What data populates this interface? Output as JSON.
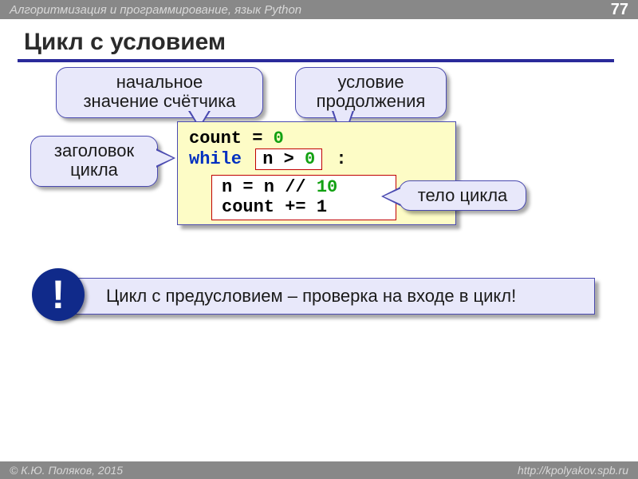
{
  "header": {
    "course": "Алгоритмизация и программирование, язык Python",
    "page": "77"
  },
  "title": "Цикл с условием",
  "callouts": {
    "initial": "начальное\nзначение счётчика",
    "condition": "условие продолжения",
    "header": "заголовок цикла",
    "body": "тело цикла"
  },
  "code": {
    "l1_a": "count = ",
    "l1_zero": "0",
    "l2_kw": "while",
    "l2_cond_a": "n > ",
    "l2_cond_zero": "0",
    "l2_colon": " :",
    "body1_a": "n = n // ",
    "body1_ten": "10",
    "body2": "count += 1"
  },
  "note": "Цикл с предусловием – проверка на входе в цикл!",
  "bang": "!",
  "footer": {
    "author": "© К.Ю. Поляков, 2015",
    "url": "http://kpolyakov.spb.ru"
  }
}
